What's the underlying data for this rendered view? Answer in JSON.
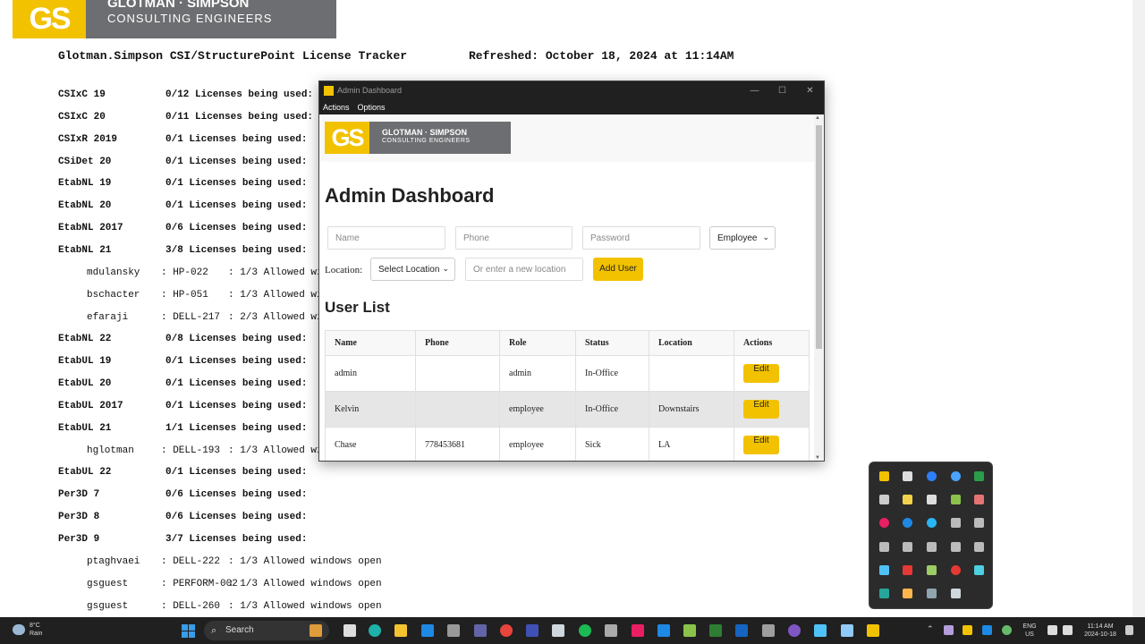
{
  "background_page": {
    "logo": {
      "mark": "GS",
      "line1": "GLOTMAN · SIMPSON",
      "line2": "CONSULTING ENGINEERS"
    },
    "title": "Glotman.Simpson CSI/StructurePoint License Tracker",
    "refreshed": "Refreshed: October 18, 2024 at 11:14AM",
    "rows": [
      {
        "type": "license",
        "product": "CSIxC 19",
        "status": "0/12 Licenses being used:"
      },
      {
        "type": "license",
        "product": "CSIxC 20",
        "status": "0/11 Licenses being used:"
      },
      {
        "type": "license",
        "product": "CSIxR 2019",
        "status": "0/1 Licenses being used:"
      },
      {
        "type": "license",
        "product": "CSiDet 20",
        "status": "0/1 Licenses being used:"
      },
      {
        "type": "license",
        "product": "EtabNL 19",
        "status": "0/1 Licenses being used:"
      },
      {
        "type": "license",
        "product": "EtabNL 20",
        "status": "0/1 Licenses being used:"
      },
      {
        "type": "license",
        "product": "EtabNL 2017",
        "status": "0/6 Licenses being used:"
      },
      {
        "type": "license",
        "product": "EtabNL 21",
        "status": "3/8 Licenses being used:"
      },
      {
        "type": "user",
        "user": "mdulansky",
        "machine": ": HP-022",
        "windows": ": 1/3 Allowed wi"
      },
      {
        "type": "user",
        "user": "bschacter",
        "machine": ": HP-051",
        "windows": ": 1/3 Allowed wi"
      },
      {
        "type": "user",
        "user": "efaraji",
        "machine": ": DELL-217",
        "windows": ": 2/3 Allowed wi"
      },
      {
        "type": "license",
        "product": "EtabNL 22",
        "status": "0/8 Licenses being used:"
      },
      {
        "type": "license",
        "product": "EtabUL 19",
        "status": "0/1 Licenses being used:"
      },
      {
        "type": "license",
        "product": "EtabUL 20",
        "status": "0/1 Licenses being used:"
      },
      {
        "type": "license",
        "product": "EtabUL 2017",
        "status": "0/1 Licenses being used:"
      },
      {
        "type": "license",
        "product": "EtabUL 21",
        "status": "1/1 Licenses being used:"
      },
      {
        "type": "user",
        "user": "hglotman",
        "machine": ": DELL-193",
        "windows": ": 1/3 Allowed wi"
      },
      {
        "type": "license",
        "product": "EtabUL 22",
        "status": "0/1 Licenses being used:"
      },
      {
        "type": "license",
        "product": "Per3D 7",
        "status": "0/6 Licenses being used:"
      },
      {
        "type": "license",
        "product": "Per3D 8",
        "status": "0/6 Licenses being used:"
      },
      {
        "type": "license",
        "product": "Per3D 9",
        "status": "3/7 Licenses being used:"
      },
      {
        "type": "user",
        "user": "ptaghvaei",
        "machine": ": DELL-222",
        "windows": ": 1/3 Allowed windows open"
      },
      {
        "type": "user",
        "user": "gsguest",
        "machine": ": PERFORM-002",
        "windows": ": 1/3 Allowed windows open"
      },
      {
        "type": "user",
        "user": "gsguest",
        "machine": ": DELL-260",
        "windows": ": 1/3 Allowed windows open"
      }
    ]
  },
  "window": {
    "title": "Admin Dashboard",
    "controls": {
      "minimize": "—",
      "maximize": "☐",
      "close": "✕"
    },
    "menu": [
      "Actions",
      "Options"
    ],
    "logo": {
      "mark": "GS",
      "line1": "GLOTMAN · SIMPSON",
      "line2": "CONSULTING ENGINEERS"
    },
    "heading": "Admin Dashboard",
    "form": {
      "name_placeholder": "Name",
      "phone_placeholder": "Phone",
      "password_placeholder": "Password",
      "role_selected": "Employee",
      "location_label": "Location:",
      "location_selected": "Select Location",
      "new_location_placeholder": "Or enter a new location",
      "add_button": "Add User"
    },
    "user_list_heading": "User List",
    "table": {
      "columns": [
        "Name",
        "Phone",
        "Role",
        "Status",
        "Location",
        "Actions"
      ],
      "rows": [
        {
          "name": "admin",
          "phone": "",
          "role": "admin",
          "status": "In-Office",
          "location": "",
          "action": "Edit"
        },
        {
          "name": "Kelvin",
          "phone": "",
          "role": "employee",
          "status": "In-Office",
          "location": "Downstairs",
          "action": "Edit"
        },
        {
          "name": "Chase",
          "phone": "778453681",
          "role": "employee",
          "status": "Sick",
          "location": "LA",
          "action": "Edit"
        }
      ]
    }
  },
  "taskbar": {
    "weather": {
      "temp": "8°C",
      "condition": "Rain"
    },
    "search": "Search",
    "lang": {
      "line1": "ENG",
      "line2": "US"
    },
    "time": "11:14 AM",
    "date": "2024-10-18"
  },
  "colors": {
    "accent": "#f2c200",
    "logo_gray": "#6d6e71",
    "titlebar": "#202020"
  }
}
